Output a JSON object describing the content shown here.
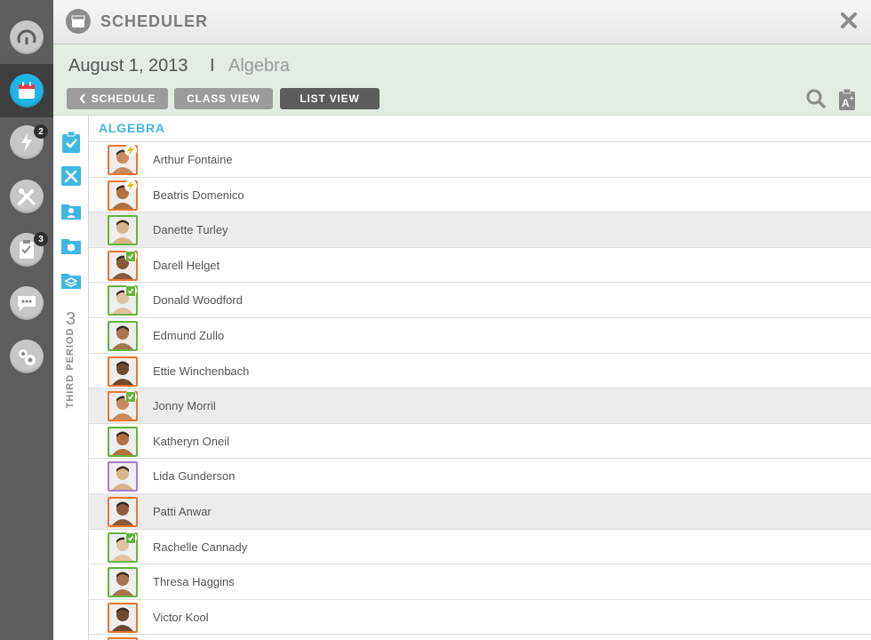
{
  "rail": {
    "items": [
      {
        "icon": "gauge-icon",
        "badge": ""
      },
      {
        "icon": "calendar-icon",
        "badge": "",
        "active": true
      },
      {
        "icon": "lightning-icon",
        "badge": "2"
      },
      {
        "icon": "tools-icon",
        "badge": ""
      },
      {
        "icon": "gradebook-icon",
        "badge": "3"
      },
      {
        "icon": "chat-icon",
        "badge": ""
      },
      {
        "icon": "settings-icon",
        "badge": ""
      }
    ]
  },
  "header": {
    "title": "SCHEDULER",
    "icon": "calendar-icon",
    "close_icon": "close-icon"
  },
  "subheader": {
    "date": "August 1, 2013",
    "separator": "I",
    "subject": "Algebra",
    "buttons": {
      "schedule": "SCHEDULE",
      "class_view": "CLASS VIEW",
      "list_view": "LIST VIEW"
    },
    "active_view": "LIST VIEW"
  },
  "strip": {
    "icons": [
      "clipboard-check-icon",
      "tools-icon",
      "folder-user-icon",
      "folder-box-icon",
      "folder-stack-icon"
    ],
    "period_number": "3",
    "period_label": "THIRD PERIOD"
  },
  "list": {
    "title": "ALGEBRA",
    "students": [
      {
        "name": "Arthur Fontaine",
        "border": "orange",
        "status": "lightning"
      },
      {
        "name": "Beatris Domenico",
        "border": "orange",
        "status": "lightning"
      },
      {
        "name": "Danette Turley",
        "border": "green",
        "status": ""
      },
      {
        "name": "Darell Helget",
        "border": "orange",
        "status": "clipboard"
      },
      {
        "name": "Donald Woodford",
        "border": "green",
        "status": "clipboard"
      },
      {
        "name": "Edmund Zullo",
        "border": "green",
        "status": ""
      },
      {
        "name": "Ettie Winchenbach",
        "border": "orange",
        "status": ""
      },
      {
        "name": "Jonny Morril",
        "border": "orange",
        "status": "clipboard"
      },
      {
        "name": "Katheryn Oneil",
        "border": "green",
        "status": ""
      },
      {
        "name": "Lida Gunderson",
        "border": "purple",
        "status": ""
      },
      {
        "name": "Patti Anwar",
        "border": "orange",
        "status": ""
      },
      {
        "name": "Rachelle Cannady",
        "border": "green",
        "status": "clipboard"
      },
      {
        "name": "Thresa Haggins",
        "border": "green",
        "status": ""
      },
      {
        "name": "Victor Kool",
        "border": "orange",
        "status": ""
      },
      {
        "name": "",
        "border": "orange",
        "status": ""
      }
    ],
    "highlighted": [
      "Danette Turley",
      "Jonny Morril",
      "Patti Anwar"
    ]
  },
  "colors": {
    "accent": "#3fb7e4",
    "orange": "#e9762e",
    "green": "#64b33b",
    "purple": "#a87cc6"
  }
}
